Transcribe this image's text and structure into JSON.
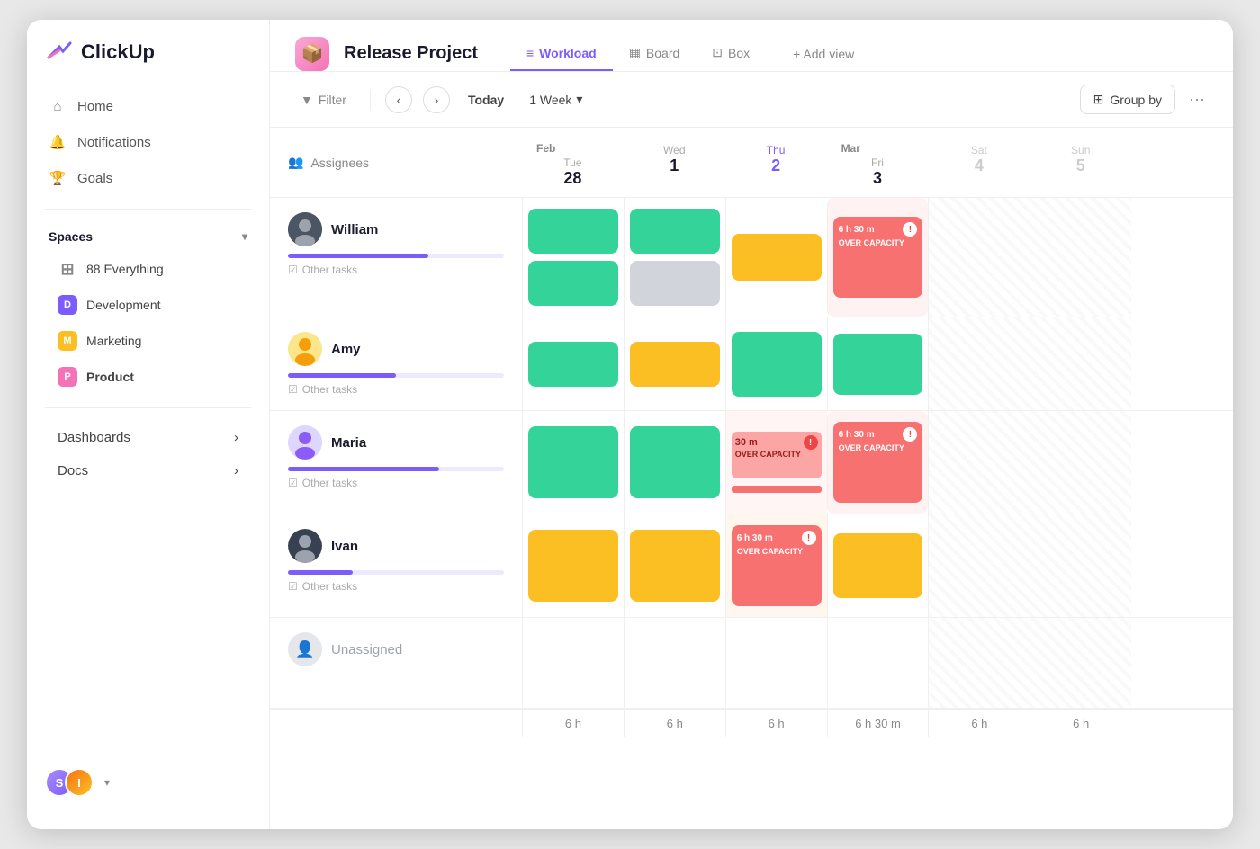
{
  "app": {
    "name": "ClickUp"
  },
  "sidebar": {
    "nav": [
      {
        "id": "home",
        "label": "Home",
        "icon": "home"
      },
      {
        "id": "notifications",
        "label": "Notifications",
        "icon": "bell"
      },
      {
        "id": "goals",
        "label": "Goals",
        "icon": "trophy"
      }
    ],
    "spaces_label": "Spaces",
    "spaces": [
      {
        "id": "everything",
        "label": "88 Everything",
        "badge": "all"
      },
      {
        "id": "development",
        "label": "Development",
        "badge": "D",
        "color": "#7c5cfc"
      },
      {
        "id": "marketing",
        "label": "Marketing",
        "badge": "M",
        "color": "#fbbf24"
      },
      {
        "id": "product",
        "label": "Product",
        "badge": "P",
        "color": "#f472b6",
        "bold": true
      }
    ],
    "sections": [
      {
        "id": "dashboards",
        "label": "Dashboards"
      },
      {
        "id": "docs",
        "label": "Docs"
      }
    ]
  },
  "header": {
    "project_name": "Release Project",
    "tabs": [
      {
        "id": "workload",
        "label": "Workload",
        "active": true
      },
      {
        "id": "board",
        "label": "Board"
      },
      {
        "id": "box",
        "label": "Box"
      }
    ],
    "add_view_label": "+ Add view"
  },
  "toolbar": {
    "filter_label": "Filter",
    "today_label": "Today",
    "week_label": "1 Week",
    "group_by_label": "Group by"
  },
  "grid": {
    "assignees_label": "Assignees",
    "months": [
      {
        "label": "Feb",
        "cols": 2
      },
      {
        "label": "Mar",
        "cols": 5
      }
    ],
    "days": [
      {
        "day": "Tue",
        "date": "28",
        "month_label": "Feb",
        "today": false
      },
      {
        "day": "Wed",
        "date": "1",
        "today": false
      },
      {
        "day": "Thu",
        "date": "2",
        "today": true
      },
      {
        "day": "Fri",
        "date": "3",
        "today": false
      },
      {
        "day": "Sat",
        "date": "4",
        "month_label": "Mar",
        "today": false
      },
      {
        "day": "Sun",
        "date": "5",
        "today": false
      }
    ],
    "persons": [
      {
        "name": "William",
        "progress": 65,
        "cells": [
          {
            "type": "green",
            "height": 80
          },
          {
            "type": "gray",
            "height": 50
          },
          {
            "type": "empty"
          },
          {
            "type": "over_capacity",
            "label": "6 h 30 m",
            "sub": "OVER CAPACITY"
          },
          {
            "type": "weekend"
          },
          {
            "type": "weekend"
          }
        ]
      },
      {
        "name": "Amy",
        "progress": 50,
        "cells": [
          {
            "type": "green_small"
          },
          {
            "type": "orange_small"
          },
          {
            "type": "green_large"
          },
          {
            "type": "green_med"
          },
          {
            "type": "weekend"
          },
          {
            "type": "weekend"
          }
        ]
      },
      {
        "name": "Maria",
        "progress": 70,
        "cells": [
          {
            "type": "green"
          },
          {
            "type": "green"
          },
          {
            "type": "over_capacity_small",
            "label": "30 m",
            "sub": "OVER CAPACITY"
          },
          {
            "type": "over_capacity",
            "label": "6 h 30 m",
            "sub": "OVER CAPACITY"
          },
          {
            "type": "weekend"
          },
          {
            "type": "weekend"
          }
        ]
      },
      {
        "name": "Ivan",
        "progress": 30,
        "cells": [
          {
            "type": "orange"
          },
          {
            "type": "orange"
          },
          {
            "type": "over_capacity_orange",
            "label": "6 h 30 m",
            "sub": "OVER CAPACITY"
          },
          {
            "type": "orange"
          },
          {
            "type": "weekend"
          },
          {
            "type": "weekend"
          }
        ]
      }
    ],
    "unassigned_label": "Unassigned",
    "bottom_hours": [
      "6 h",
      "6 h",
      "6 h",
      "6 h 30 m",
      "6 h",
      "6 h"
    ],
    "other_tasks_label": "Other tasks"
  }
}
